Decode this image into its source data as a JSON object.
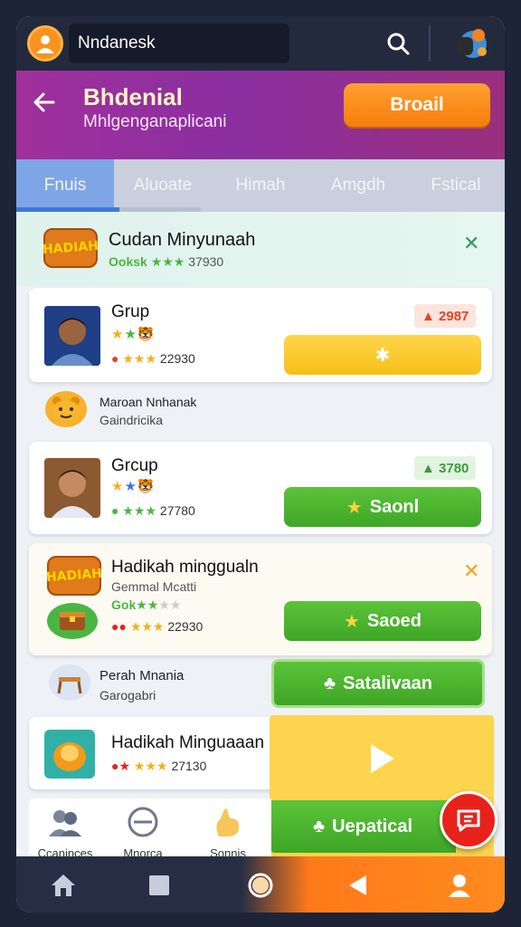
{
  "topbar": {
    "search_text": "Nndanesk"
  },
  "header": {
    "title": "Bhdenial",
    "subtitle": "Mhlgenganaplicani",
    "broadcast_label": "Broail"
  },
  "tabs": [
    {
      "label": "Fnuis",
      "active": true
    },
    {
      "label": "Aluoate",
      "active": false
    },
    {
      "label": "Himah",
      "active": false
    },
    {
      "label": "Amgdh",
      "active": false
    },
    {
      "label": "Fstical",
      "active": false
    }
  ],
  "promo": {
    "badge_text": "HADIAH",
    "title": "Cudan Minyunaah",
    "meta_green": "Ooksk",
    "meta_value": "37930"
  },
  "cards": [
    {
      "title": "Grup",
      "stats": "22930",
      "price": "2987",
      "price_color": "#e0452a",
      "action_label": "✱",
      "action_style": "yellow"
    },
    {
      "title": "Grcup",
      "stats": "27780",
      "price": "3780",
      "price_color": "#3e9a3a",
      "action_label": "Saonl",
      "action_style": "green"
    }
  ],
  "note_rows": [
    {
      "title": "Maroan Nnhanak",
      "sub": "Gaindricika"
    },
    {
      "title": "Perah Mnania",
      "sub": "Garogabri"
    }
  ],
  "promo_card": {
    "badge_text": "HADIAH",
    "title": "Hadikah minggualn",
    "sub": "Gemmal Mcatti",
    "rating_prefix": "Gok",
    "stats": "22930",
    "action_label": "Saoed"
  },
  "last_card": {
    "title": "Hadikah Minguaaan",
    "stats": "27130"
  },
  "overlay": {
    "save_label": "Satalivaan",
    "update_label": "Uepatical"
  },
  "quick_bar": [
    {
      "label": "Ccaninces"
    },
    {
      "label": "Mnorca"
    },
    {
      "label": "Sonnis"
    }
  ],
  "colors": {
    "header_purple": "#9a2f9c",
    "accent_orange": "#f7931e",
    "action_green": "#4cb52e",
    "action_yellow": "#f8c72a",
    "chat_red": "#e8221b"
  }
}
